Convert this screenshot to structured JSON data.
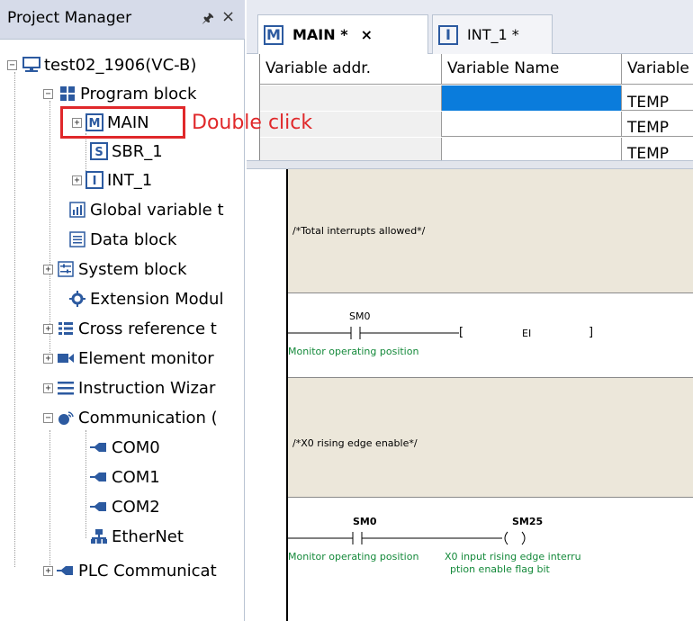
{
  "project_manager": {
    "title": "Project Manager",
    "pin_icon": "pin-icon",
    "close_icon": "close-icon",
    "tree": [
      {
        "label": "test02_1906(VC-B)",
        "icon": "plc-icon"
      },
      {
        "label": "Program block",
        "icon": "program-block-icon"
      },
      {
        "label": "MAIN",
        "icon": "main-m-icon"
      },
      {
        "label": "SBR_1",
        "icon": "sbr-s-icon"
      },
      {
        "label": "INT_1",
        "icon": "int-i-icon"
      },
      {
        "label": "Global variable t",
        "icon": "global-variable-icon"
      },
      {
        "label": "Data block",
        "icon": "data-block-icon"
      },
      {
        "label": "System block",
        "icon": "system-block-icon"
      },
      {
        "label": "Extension Modul",
        "icon": "extension-module-icon"
      },
      {
        "label": "Cross reference t",
        "icon": "cross-reference-icon"
      },
      {
        "label": "Element monitor",
        "icon": "element-monitor-icon"
      },
      {
        "label": "Instruction Wizar",
        "icon": "instruction-wizard-icon"
      },
      {
        "label": "Communication (",
        "icon": "communication-icon"
      },
      {
        "label": "COM0",
        "icon": "com-port-icon"
      },
      {
        "label": "COM1",
        "icon": "com-port-icon"
      },
      {
        "label": "COM2",
        "icon": "com-port-icon"
      },
      {
        "label": "EtherNet",
        "icon": "ethernet-icon"
      },
      {
        "label": "PLC Communicat",
        "icon": "plc-communication-icon"
      }
    ]
  },
  "annotation": {
    "text": "Double click",
    "color": "#e0282a"
  },
  "tabs": [
    {
      "label": "MAIN *",
      "icon_letter": "M",
      "close": "×",
      "active": true
    },
    {
      "label": "INT_1 *",
      "icon_letter": "I",
      "active": false
    }
  ],
  "variable_table": {
    "headers": [
      "Variable addr.",
      "Variable Name",
      "Variable"
    ],
    "rows": [
      {
        "addr": "",
        "name": "",
        "type": "TEMP",
        "selected": true
      },
      {
        "addr": "",
        "name": "",
        "type": "TEMP"
      },
      {
        "addr": "",
        "name": "",
        "type": "TEMP"
      }
    ],
    "selected_color": "#0a7cdc"
  },
  "ladder": {
    "networks": [
      {
        "comment": "/*Total interrupts allowed*/",
        "contact": "SM0",
        "contact_comment": "Monitor operating position",
        "instruction": "EI",
        "bracket_open": "[",
        "bracket_close": "]"
      },
      {
        "comment": "/*X0 rising edge enable*/",
        "contact": "SM0",
        "contact_comment": "Monitor operating position",
        "coil": "SM25",
        "coil_comment_line1": "X0 input rising edge interru",
        "coil_comment_line2": "ption enable flag bit"
      }
    ],
    "comment_band_color": "#ece7da"
  }
}
